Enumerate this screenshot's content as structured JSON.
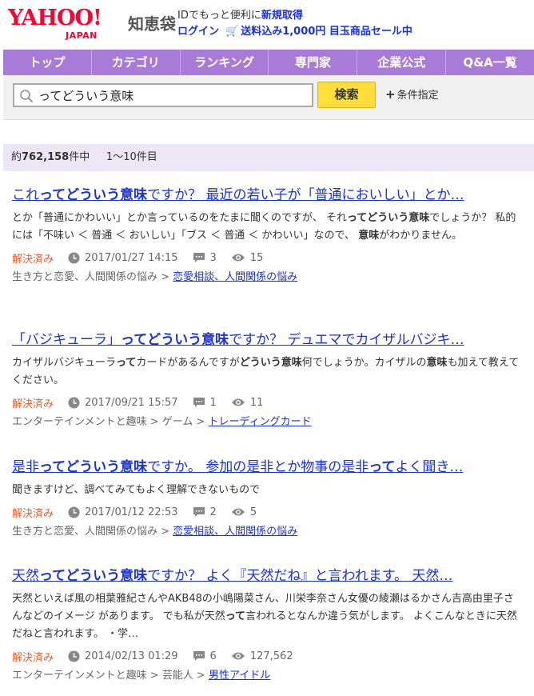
{
  "header": {
    "logo_yahoo": "YAHOO!",
    "logo_japan": "JAPAN",
    "logo_service": "知恵袋",
    "id_prefix": "IDでもっと便利に",
    "register_link": "新規取得",
    "login_link": "ログイン",
    "promo_link": "送料込み1,000円 目玉商品セール中"
  },
  "nav": {
    "items": [
      "トップ",
      "カテゴリ",
      "ランキング",
      "専門家",
      "企業公式",
      "Q&A一覧"
    ]
  },
  "search": {
    "query": "ってどういう意味",
    "button": "検索",
    "advanced": "条件指定"
  },
  "count": {
    "prefix": "約",
    "total": "762,158",
    "suffix": "件中",
    "range": "1〜10件目"
  },
  "results": [
    {
      "title_parts": [
        "これ",
        "ってどういう意味",
        "ですか？ 最近の若い子が「普通においしい」とか…"
      ],
      "desc_parts": [
        "とか「普通にかわいい」とか言っているのをたまに聞くのですが、 それ",
        "ってどういう意味",
        "でしょうか？ 私的には「不味い ＜ 普通 ＜ おいしい」「ブス ＜ 普通 ＜ かわいい」なので、",
        "意味",
        "がわかりません。"
      ],
      "status": "解決済み",
      "date": "2017/01/27 14:15",
      "answers": "3",
      "views": "15",
      "cat_path": "生き方と恋愛、人間関係の悩み >",
      "cat_link": "恋愛相談、人間関係の悩み"
    },
    {
      "title_parts": [
        "「バジキューラ」",
        "ってどういう意味",
        "ですか？ デュエマでカイザルバジキ…"
      ],
      "desc_parts": [
        "カイザルバジキューラ",
        "って",
        "カードがあるんですが",
        "どういう意味",
        "何でしょうか。カイザルの",
        "意味",
        "も加えて教えてください。"
      ],
      "status": "解決済み",
      "date": "2017/09/21 15:57",
      "answers": "1",
      "views": "11",
      "cat_path": "エンターテインメントと趣味 > ゲーム >",
      "cat_link": "トレーディングカード"
    },
    {
      "title_parts": [
        "是非",
        "ってどういう意味",
        "ですか。 参加の是非とか物事の是非",
        "って",
        "よく聞き…"
      ],
      "desc_parts": [
        "聞きますけど、調べてみてもよく理解できないもので"
      ],
      "status": "解決済み",
      "date": "2017/01/12 22:53",
      "answers": "2",
      "views": "5",
      "cat_path": "生き方と恋愛、人間関係の悩み >",
      "cat_link": "恋愛相談、人間関係の悩み"
    },
    {
      "title_parts": [
        "天然",
        "ってどういう意味",
        "ですか？ よく『天然だね』と言われます。 天然…"
      ],
      "desc_parts": [
        "天然といえば風の相葉雅紀さんやAKB48の小嶋陽菜さん、川栄李奈さん女優の綾瀬はるかさん吉高由里子さんなどのイメージ があります。 でも私が天然",
        "って",
        "言われるとなんか違う気がします。 よくこんなときに天然だねと言われます。 ・学…"
      ],
      "status": "解決済み",
      "date": "2014/02/13 01:29",
      "answers": "6",
      "views": "127,562",
      "cat_path": "エンターテインメントと趣味 > 芸能人 >",
      "cat_link": "男性アイドル"
    }
  ],
  "colors": {
    "nav_bg": "#a97bd9",
    "link": "#1a33d3",
    "solved": "#e0622e",
    "search_btn": "#ffde3a",
    "count_bg": "#ece6f5"
  }
}
